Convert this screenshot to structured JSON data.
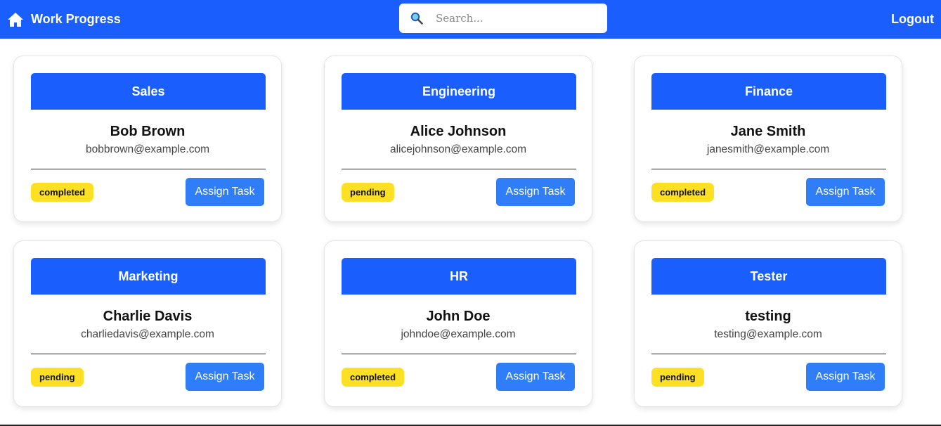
{
  "header": {
    "title": "Work Progress",
    "search_placeholder": "Search...",
    "search_value": "",
    "logout_label": "Logout",
    "brand_color": "#1a5ffe"
  },
  "employees": [
    {
      "department": "Sales",
      "name": "Bob Brown",
      "email": "bobbrown@example.com",
      "status": "completed",
      "action": "Assign Task"
    },
    {
      "department": "Engineering",
      "name": "Alice Johnson",
      "email": "alicejohnson@example.com",
      "status": "pending",
      "action": "Assign Task"
    },
    {
      "department": "Finance",
      "name": "Jane Smith",
      "email": "janesmith@example.com",
      "status": "completed",
      "action": "Assign Task"
    },
    {
      "department": "Marketing",
      "name": "Charlie Davis",
      "email": "charliedavis@example.com",
      "status": "pending",
      "action": "Assign Task"
    },
    {
      "department": "HR",
      "name": "John Doe",
      "email": "johndoe@example.com",
      "status": "completed",
      "action": "Assign Task"
    },
    {
      "department": "Tester",
      "name": "testing",
      "email": "testing@example.com",
      "status": "pending",
      "action": "Assign Task"
    }
  ],
  "colors": {
    "accent": "#1a5ffe",
    "button": "#2f7df7",
    "status_badge": "#fde023"
  },
  "icons": {
    "home": "home-icon",
    "search": "search-icon"
  }
}
